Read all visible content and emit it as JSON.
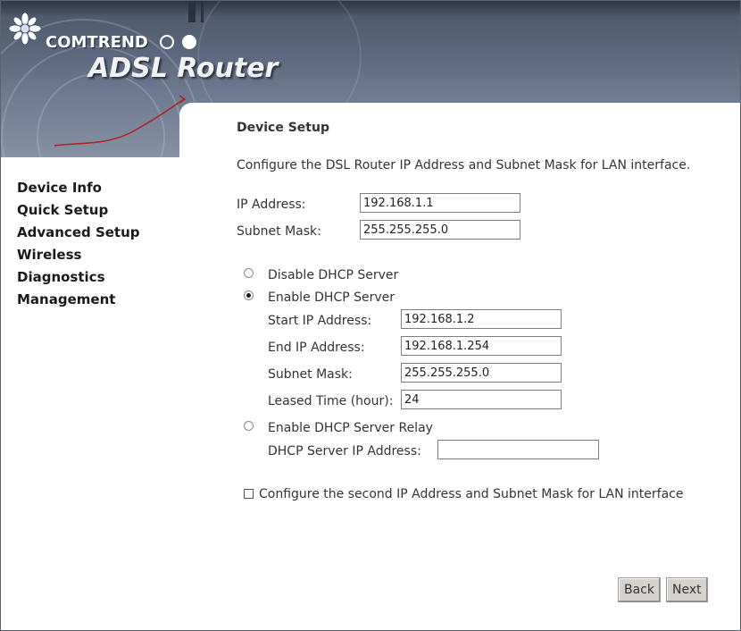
{
  "brand": {
    "company": "COMTREND",
    "product": "ADSL Router"
  },
  "nav": {
    "items": [
      {
        "label": "Device Info"
      },
      {
        "label": "Quick Setup"
      },
      {
        "label": "Advanced Setup"
      },
      {
        "label": "Wireless"
      },
      {
        "label": "Diagnostics"
      },
      {
        "label": "Management"
      }
    ]
  },
  "page": {
    "title": "Device Setup",
    "description": "Configure the DSL Router IP Address and Subnet Mask for LAN interface."
  },
  "lan": {
    "ip_label": "IP Address:",
    "ip_value": "192.168.1.1",
    "mask_label": "Subnet Mask:",
    "mask_value": "255.255.255.0"
  },
  "dhcp": {
    "disable_label": "Disable DHCP Server",
    "enable_label": "Enable DHCP Server",
    "relay_label": "Enable DHCP Server Relay",
    "selected": "enable",
    "start_label": "Start IP Address:",
    "start_value": "192.168.1.2",
    "end_label": "End IP Address:",
    "end_value": "192.168.1.254",
    "mask_label": "Subnet Mask:",
    "mask_value": "255.255.255.0",
    "lease_label": "Leased Time (hour):",
    "lease_value": "24",
    "relay_ip_label": "DHCP Server IP Address:",
    "relay_ip_value": ""
  },
  "second_ip": {
    "label": "Configure the second IP Address and Subnet Mask for LAN interface",
    "checked": false
  },
  "buttons": {
    "back": "Back",
    "next": "Next"
  },
  "colors": {
    "sidebar_border": "#9a1e1e",
    "banner": "#59657a"
  }
}
